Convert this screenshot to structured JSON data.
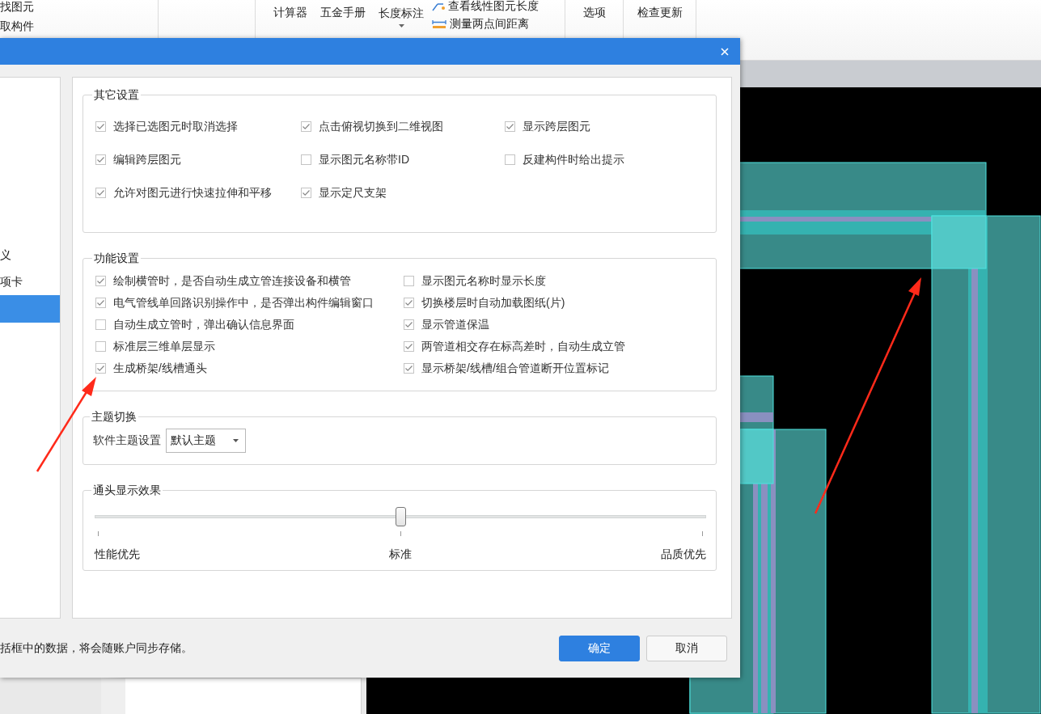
{
  "toolbar": {
    "left_items": [
      "找图元",
      "取构件"
    ],
    "buttons": [
      {
        "label": "计算器",
        "kind": "plain"
      },
      {
        "label": "五金手册",
        "kind": "plain"
      },
      {
        "label": "长度标注",
        "kind": "dropdown"
      }
    ],
    "measure_items": [
      {
        "label": "查看线性图元长度",
        "kind": "line"
      },
      {
        "label": "测量两点间距离",
        "kind": "ruler"
      }
    ],
    "right_buttons": [
      "选项",
      "检查更新"
    ]
  },
  "sidebar": {
    "items": [
      {
        "label": "义",
        "selected": false
      },
      {
        "label": "项卡",
        "selected": false
      },
      {
        "selected": true
      }
    ]
  },
  "other_settings": {
    "title": "其它设置",
    "rows": [
      [
        {
          "label": "选择已选图元时取消选择",
          "checked": true
        },
        {
          "label": "点击俯视切换到二维视图",
          "checked": true
        },
        {
          "label": "显示跨层图元",
          "checked": true
        }
      ],
      [
        {
          "label": "编辑跨层图元",
          "checked": true
        },
        {
          "label": "显示图元名称带ID",
          "checked": false
        },
        {
          "label": "反建构件时给出提示",
          "checked": false
        }
      ],
      [
        {
          "label": "允许对图元进行快速拉伸和平移",
          "checked": true
        },
        {
          "label": "显示定尺支架",
          "checked": true
        }
      ]
    ]
  },
  "function_settings": {
    "title": "功能设置",
    "rows": [
      [
        {
          "label": "绘制横管时，是否自动生成立管连接设备和横管",
          "checked": true
        },
        {
          "label": "显示图元名称时显示长度",
          "checked": false
        }
      ],
      [
        {
          "label": "电气管线单回路识别操作中，是否弹出构件编辑窗口",
          "checked": true
        },
        {
          "label": "切换楼层时自动加载图纸(片)",
          "checked": true
        }
      ],
      [
        {
          "label": "自动生成立管时，弹出确认信息界面",
          "checked": false
        },
        {
          "label": "显示管道保温",
          "checked": true
        }
      ],
      [
        {
          "label": "标准层三维单层显示",
          "checked": false
        },
        {
          "label": "两管道相交存在标高差时，自动生成立管",
          "checked": true
        }
      ],
      [
        {
          "label": "生成桥架/线槽通头",
          "checked": true
        },
        {
          "label": "显示桥架/线槽/组合管道断开位置标记",
          "checked": true
        }
      ]
    ]
  },
  "theme": {
    "title": "主题切换",
    "label": "软件主题设置",
    "value": "默认主题"
  },
  "fitting_effect": {
    "title": "通头显示效果",
    "level": 0.5,
    "labels": [
      "性能优先",
      "标准",
      "品质优先"
    ]
  },
  "footer": {
    "note": "括框中的数据，将会随账户同步存储。",
    "buttons": [
      {
        "label": "确定",
        "kind": "primary"
      },
      {
        "label": "取消",
        "kind": "secondary"
      }
    ]
  }
}
